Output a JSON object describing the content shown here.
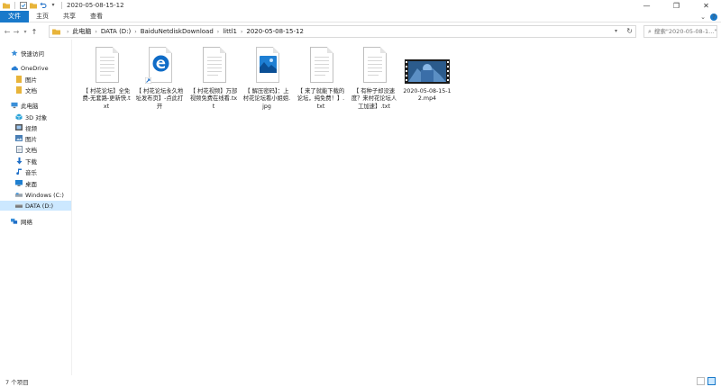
{
  "window": {
    "title": "2020-05-08-15-12",
    "controls": {
      "minimize": "—",
      "maximize": "❐",
      "close": "✕"
    }
  },
  "ribbon": {
    "tabs": [
      "文件",
      "主页",
      "共享",
      "查看"
    ],
    "expand": "⌄",
    "help": "?"
  },
  "address": {
    "crumbs": [
      "此电脑",
      "DATA (D:)",
      "BaiduNetdiskDownload",
      "littl1",
      "2020-05-08-15-12"
    ],
    "search_placeholder": "搜索\"2020-05-08-1...\""
  },
  "nav": {
    "items": [
      {
        "label": "快速访问",
        "icon": "star-icon",
        "color": "#3b8ed8"
      },
      {
        "label": "OneDrive",
        "icon": "cloud-icon",
        "color": "#2a7fd4"
      },
      {
        "label": "图片",
        "icon": "folder-icon",
        "color": "#e8b43a"
      },
      {
        "label": "文档",
        "icon": "folder-icon",
        "color": "#e8b43a"
      },
      {
        "label": "此电脑",
        "icon": "computer-icon",
        "color": "#3a8fd8"
      },
      {
        "label": "3D 对象",
        "icon": "cube-icon",
        "color": "#2aa3d8"
      },
      {
        "label": "视频",
        "icon": "video-icon",
        "color": "#555555"
      },
      {
        "label": "图片",
        "icon": "picture-icon",
        "color": "#4a7fb5"
      },
      {
        "label": "文档",
        "icon": "document-icon",
        "color": "#7a8ea3"
      },
      {
        "label": "下载",
        "icon": "download-icon",
        "color": "#1f6fc7"
      },
      {
        "label": "音乐",
        "icon": "music-icon",
        "color": "#1f6fc7"
      },
      {
        "label": "桌面",
        "icon": "desktop-icon",
        "color": "#1f7fd0"
      },
      {
        "label": "Windows (C:)",
        "icon": "drive-icon",
        "color": "#3a8fd8"
      },
      {
        "label": "DATA (D:)",
        "icon": "drive-icon",
        "color": "#777777"
      },
      {
        "label": "网络",
        "icon": "network-icon",
        "color": "#3a8fd8"
      }
    ]
  },
  "files": [
    {
      "name": "【 村花论坛】全免费-无套路-更新快.txt",
      "type": "txt"
    },
    {
      "name": "【 村花论坛永久地址发布页】-点此打开",
      "type": "edge-shortcut"
    },
    {
      "name": "【 村花视频】万部视频免费在线看.txt",
      "type": "txt"
    },
    {
      "name": "【 解压密码】：上村花论坛看小姐姐.jpg",
      "type": "jpg"
    },
    {
      "name": "【 来了就能下载的论坛，纯免费！】.txt",
      "type": "txt"
    },
    {
      "name": "【 有种子却没速度？来村花论坛人工加速】.txt",
      "type": "txt"
    },
    {
      "name": "2020-05-08-15-12.mp4",
      "type": "mp4"
    }
  ],
  "status": {
    "item_count": "7 个项目"
  },
  "colors": {
    "accent": "#1979ca",
    "selection": "#cce8ff",
    "edge": "#0f6cc7"
  }
}
